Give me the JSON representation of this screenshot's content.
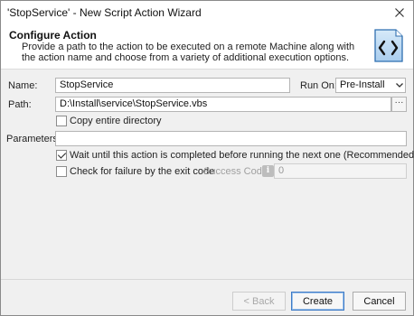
{
  "window": {
    "title": "'StopService' - New Script Action Wizard"
  },
  "header": {
    "title": "Configure Action",
    "description": "Provide a path to the action to be executed on a remote Machine along with the action name and choose from a variety of additional execution options.",
    "icon": "script-code-icon"
  },
  "form": {
    "name_label": "Name:",
    "name_value": "StopService",
    "run_on_label": "Run On:",
    "run_on_value": "Pre-Install",
    "path_label": "Path:",
    "path_value": "D:\\Install\\service\\StopService.vbs",
    "browse_label": "···",
    "copy_dir_label": "Copy entire directory",
    "copy_dir_checked": false,
    "parameters_label": "Parameters:",
    "parameters_value": "",
    "wait_label": "Wait until this action is completed before running the next one (Recommended)",
    "wait_checked": true,
    "check_failure_label": "Check for failure by the exit code",
    "check_failure_checked": false,
    "success_codes_label": "Success Codes:",
    "success_codes_value": "0",
    "info_icon_text": "i"
  },
  "footer": {
    "back_label": "< Back",
    "create_label": "Create",
    "cancel_label": "Cancel"
  }
}
